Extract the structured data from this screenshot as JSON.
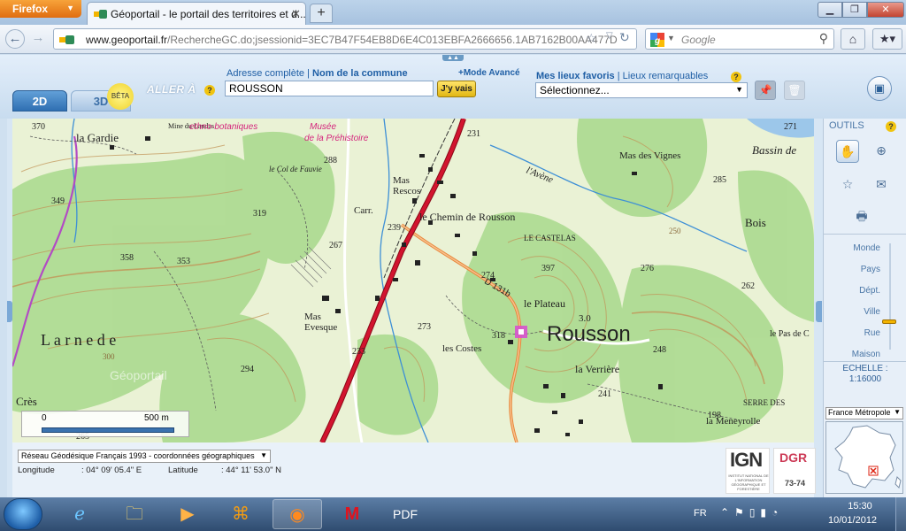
{
  "browser": {
    "menu_label": "Firefox",
    "tab_title": "Géoportail - le portail des territoires et d...",
    "url_domain": "www.geoportail.fr",
    "url_rest": "/RechercheGC.do;jsessionid=3EC7B47F54EB8D6E4C013EBFA2666656.1AB7162B00AA477D",
    "search_placeholder": "Google"
  },
  "geoportail": {
    "tabs": [
      "2D",
      "3D"
    ],
    "beta_label": "BÊTA",
    "aller_label": "ALLER À",
    "address_link": "Adresse complète",
    "separator": "|",
    "commune_link": "Nom de la commune",
    "mode_avance": "+Mode Avancé",
    "search_value": "ROUSSON",
    "go_button": "J'y vais",
    "favoris_label": "Mes lieux favoris",
    "remarquables_link": "Lieux remarquables",
    "favoris_select": "Sélectionnez...",
    "help": "?"
  },
  "map": {
    "labels": {
      "la_gardie": "la Gardie",
      "mine_landas": "Mine du Landas",
      "ethno": "ethno-botaniques",
      "musee": "Musée",
      "prehistoire": "de la Préhistoire",
      "col_fauvie": "le Col de Fauvie",
      "mas_rescos": "Mas Rescos",
      "chemin_rousson": "le Chemin de Rousson",
      "carr": "Carr.",
      "lavene": "l'Avène",
      "mas_vignes": "Mas des Vignes",
      "bassin": "Bassin de",
      "bois": "Bois",
      "le_castelas": "LE CASTELAS",
      "d131": "D 131b",
      "le_plateau": "le Plateau",
      "rousson": "Rousson",
      "mas_evesque": "Mas Evesque",
      "larnede": "L a r n e d e",
      "les_costes": "les Costes",
      "la_verriere": "la Verrière",
      "le_pas": "le Pas de C",
      "serre": "SERRE DES",
      "meneyrolle": "la Meneyrolle",
      "cres": "Crès",
      "geoportail_wm": "Géoportail"
    },
    "elevations": [
      "370",
      "349",
      "358",
      "353",
      "319",
      "288",
      "267",
      "239",
      "231",
      "274",
      "397",
      "276",
      "262",
      "285",
      "271",
      "273",
      "318",
      "233",
      "294",
      "248",
      "241",
      "300",
      "250",
      "198",
      "265"
    ],
    "rousson_alt": "3.0",
    "scale": {
      "zero": "0",
      "length": "500 m"
    },
    "projection": "Réseau Géodésique Français 1993 - coordonnées géographiques",
    "longitude_label": "Longitude",
    "longitude_value": ": 04° 09' 05.4\" E",
    "latitude_label": "Latitude",
    "latitude_value": ": 44° 11' 53.0\" N",
    "ign_logo": "IGN",
    "ign_sub": "INSTITUT NATIONAL DE L'INFORMATION GÉOGRAPHIQUE ET FORESTIÈRE",
    "dgr_logo": "DGR",
    "dgr_num": "73-74"
  },
  "outils": {
    "title": "OUTILS",
    "zoom_levels": [
      "Monde",
      "Pays",
      "Dépt.",
      "Ville",
      "Rue",
      "Maison"
    ],
    "zoom_level_active": "Rue",
    "echelle_label": "ECHELLE :",
    "echelle_value": "1:16000",
    "region": "France Métropole"
  },
  "taskbar": {
    "lang": "FR",
    "time": "15:30",
    "date": "10/01/2012"
  },
  "colors": {
    "accent": "#2f6fb2",
    "road_main": "#c8102e",
    "road_secondary": "#e8873a",
    "poi": "#d4247c",
    "terrain": "#8fce7e",
    "contour": "#c29356"
  }
}
